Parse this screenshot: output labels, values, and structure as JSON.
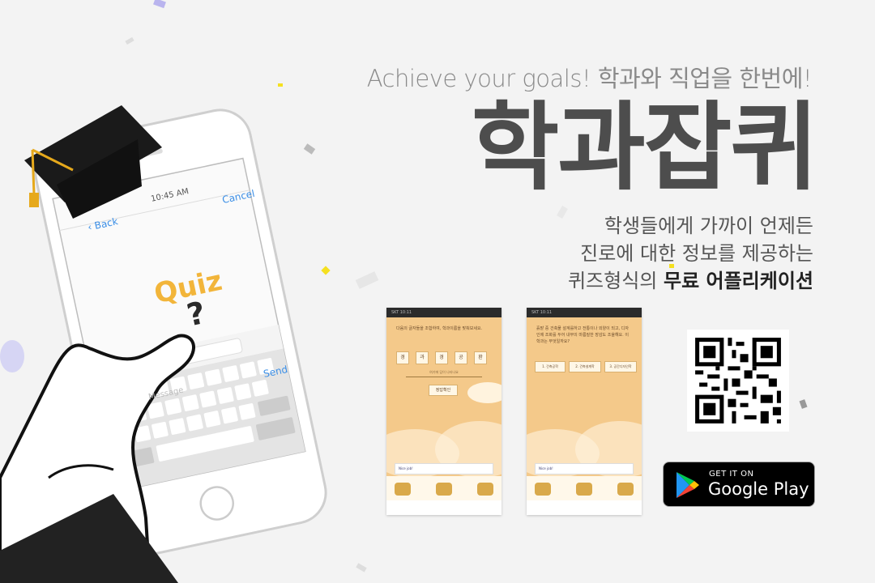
{
  "tagline": "Achieve your goals! 학과와 직업을 한번에!",
  "app_title": "학과잡퀴",
  "description": {
    "line1": "학생들에게 가까이 언제든",
    "line2": "진로에 대한 정보를 제공하는",
    "line3_prefix": "퀴즈형식의 ",
    "line3_strong": "무료 어플리케이션"
  },
  "phone": {
    "time": "10:45 AM",
    "back_label": "Back",
    "cancel_label": "Cancel",
    "quiz_logo": "Quiz",
    "message_placeholder": "Message",
    "send_label": "Send"
  },
  "screenshot1": {
    "question": "다음의 글자들을 조합하여, 학과이름을 맞춰보세요.",
    "tiles": [
      "경",
      "과",
      "경",
      "공",
      "환"
    ],
    "answer_hint": "여기에 답이 나타나요",
    "submit": "정답확인",
    "ad_brand": "Nice job!"
  },
  "screenshot2": {
    "question": "흙밭 중 건축물 설계를하고 전통이나 외양이 되고, 디자인에 조화를 두어 내부의 마름질한 장감도 조율해요. 이 학과는 무엇일까요?",
    "options": [
      "1. 건축공학",
      "2. 건축설계학",
      "3. 공간디자인학"
    ],
    "ad_brand": "Nice job!"
  },
  "store_badge": {
    "get_it_on": "GET IT ON",
    "store_name": "Google Play"
  },
  "colors": {
    "background": "#f3f3f3",
    "title": "#4d4d4d",
    "quiz_yellow": "#f2b53a",
    "screenshot_bg": "#f4c98a"
  }
}
